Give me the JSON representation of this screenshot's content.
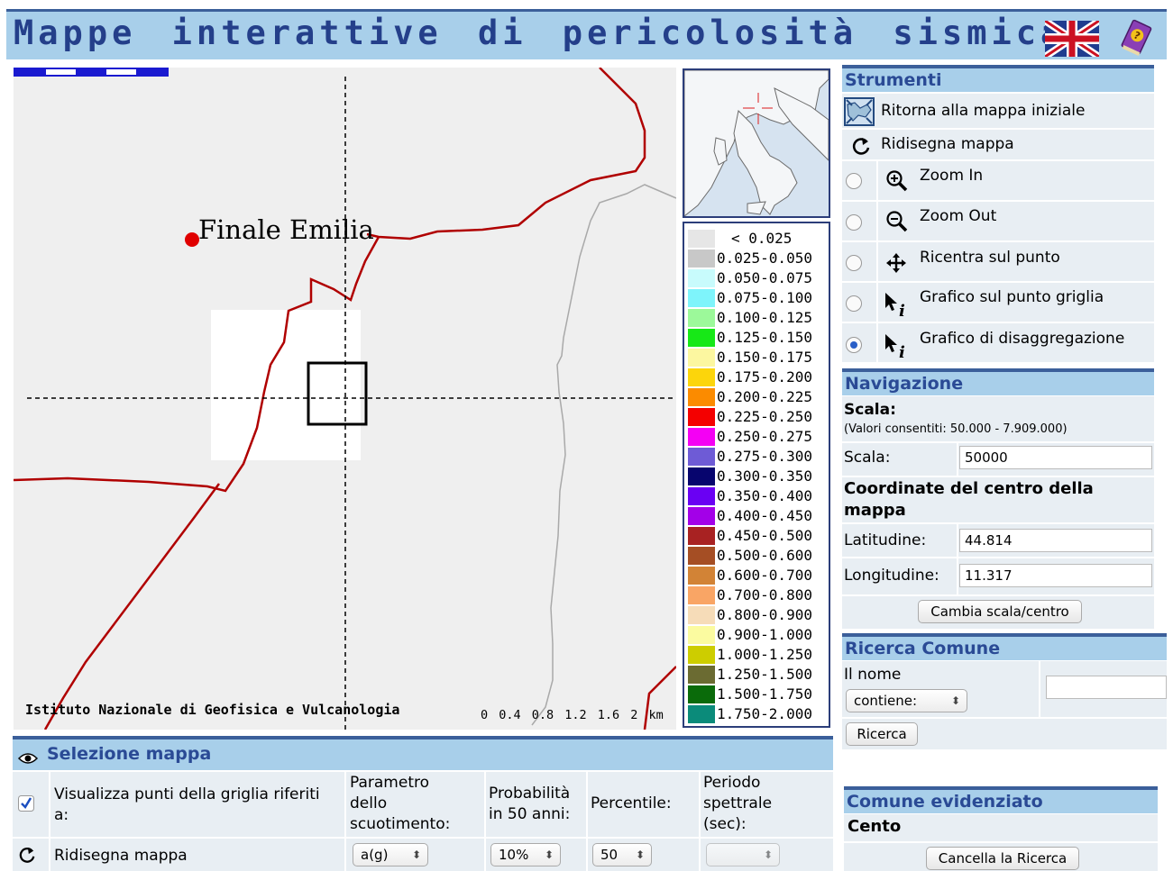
{
  "header": {
    "title": "Mappe interattive di pericolosità sismica",
    "language_icon": "uk-flag-icon",
    "help_icon": "help-book-icon"
  },
  "map": {
    "place_label": "Finale Emilia",
    "credit": "Istituto Nazionale di Geofisica e Vulcanologia",
    "scale_labels": "0 0.4 0.8 1.2 1.6 2 km",
    "colors": {
      "background": "#efefef",
      "border": "#b00000",
      "river": "#a9a9a9",
      "marker": "#e00000"
    }
  },
  "legend": [
    {
      "label": "< 0.025",
      "color": "#e6e6e6"
    },
    {
      "label": "0.025-0.050",
      "color": "#c8c8c8"
    },
    {
      "label": "0.050-0.075",
      "color": "#c8fbfc"
    },
    {
      "label": "0.075-0.100",
      "color": "#7ef4fb"
    },
    {
      "label": "0.100-0.125",
      "color": "#9cf99a"
    },
    {
      "label": "0.125-0.150",
      "color": "#17e817"
    },
    {
      "label": "0.150-0.175",
      "color": "#fcf7a0"
    },
    {
      "label": "0.175-0.200",
      "color": "#fcd50b"
    },
    {
      "label": "0.200-0.225",
      "color": "#fb8b00"
    },
    {
      "label": "0.225-0.250",
      "color": "#f40000"
    },
    {
      "label": "0.250-0.275",
      "color": "#f400f4"
    },
    {
      "label": "0.275-0.300",
      "color": "#6e5bd6"
    },
    {
      "label": "0.300-0.350",
      "color": "#07056e"
    },
    {
      "label": "0.350-0.400",
      "color": "#6a00f3"
    },
    {
      "label": "0.400-0.450",
      "color": "#a300e8"
    },
    {
      "label": "0.450-0.500",
      "color": "#a82222"
    },
    {
      "label": "0.500-0.600",
      "color": "#a54e24"
    },
    {
      "label": "0.600-0.700",
      "color": "#d28336"
    },
    {
      "label": "0.700-0.800",
      "color": "#f9a565"
    },
    {
      "label": "0.800-0.900",
      "color": "#f6dcb8"
    },
    {
      "label": "0.900-1.000",
      "color": "#fbfba0"
    },
    {
      "label": "1.000-1.250",
      "color": "#cdcd00"
    },
    {
      "label": "1.250-1.500",
      "color": "#6b6b32"
    },
    {
      "label": "1.500-1.750",
      "color": "#0a6b0a"
    },
    {
      "label": "1.750-2.000",
      "color": "#0b8b7a"
    }
  ],
  "tools": {
    "heading": "Strumenti",
    "reset": "Ritorna alla mappa iniziale",
    "redraw": "Ridisegna mappa",
    "zoom_in": "Zoom In",
    "zoom_out": "Zoom Out",
    "recenter": "Ricentra sul punto",
    "grid_plot": "Grafico sul punto griglia",
    "disagg_plot": "Grafico di disaggregazione",
    "selected": "disagg_plot"
  },
  "navigation": {
    "heading": "Navigazione",
    "scale_heading": "Scala:",
    "scale_note": "(Valori consentiti: 50.000 - 7.909.000)",
    "scale_label": "Scala:",
    "scale_value": "50000",
    "center_heading": "Coordinate del centro della mappa",
    "lat_label": "Latitudine:",
    "lat_value": "44.814",
    "lon_label": "Longitudine:",
    "lon_value": "11.317",
    "apply_button": "Cambia scala/centro"
  },
  "search": {
    "heading": "Ricerca Comune",
    "name_label": "Il nome",
    "mode_value": "contiene:",
    "query_value": "",
    "button": "Ricerca"
  },
  "highlighted": {
    "heading": "Comune evidenziato",
    "name": "Cento",
    "clear_button": "Cancella la Ricerca"
  },
  "selection": {
    "heading": "Selezione mappa",
    "show_points_label": "Visualizza punti della griglia riferiti a:",
    "show_points_checked": true,
    "param_label": "Parametro dello scuotimento:",
    "prob_label": "Probabilità in 50 anni:",
    "percentile_label": "Percentile:",
    "period_label": "Periodo spettrale (sec):",
    "redraw_label": "Ridisegna mappa",
    "param_value": "a(g)",
    "prob_value": "10%",
    "percentile_value": "50",
    "period_value": ""
  }
}
